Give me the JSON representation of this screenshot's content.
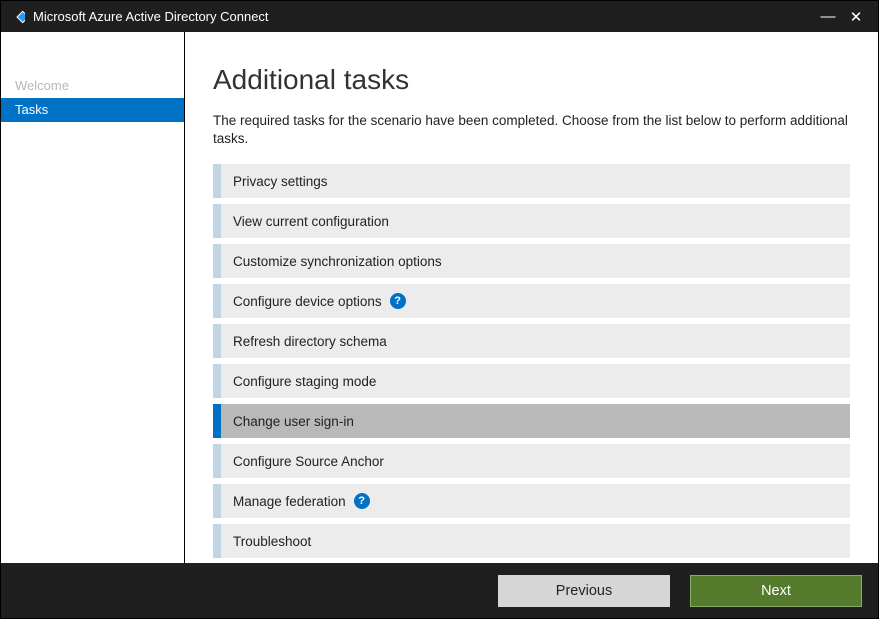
{
  "titlebar": {
    "title": "Microsoft Azure Active Directory Connect"
  },
  "sidebar": {
    "items": [
      {
        "label": "Welcome",
        "active": false
      },
      {
        "label": "Tasks",
        "active": true
      }
    ]
  },
  "main": {
    "heading": "Additional tasks",
    "description": "The required tasks for the scenario have been completed. Choose from the list below to perform additional tasks.",
    "tasks": [
      {
        "label": "Privacy settings",
        "help": false,
        "selected": false
      },
      {
        "label": "View current configuration",
        "help": false,
        "selected": false
      },
      {
        "label": "Customize synchronization options",
        "help": false,
        "selected": false
      },
      {
        "label": "Configure device options",
        "help": true,
        "selected": false
      },
      {
        "label": "Refresh directory schema",
        "help": false,
        "selected": false
      },
      {
        "label": "Configure staging mode",
        "help": false,
        "selected": false
      },
      {
        "label": "Change user sign-in",
        "help": false,
        "selected": true
      },
      {
        "label": "Configure Source Anchor",
        "help": false,
        "selected": false
      },
      {
        "label": "Manage federation",
        "help": true,
        "selected": false
      },
      {
        "label": "Troubleshoot",
        "help": false,
        "selected": false
      }
    ]
  },
  "footer": {
    "previous": "Previous",
    "next": "Next"
  }
}
